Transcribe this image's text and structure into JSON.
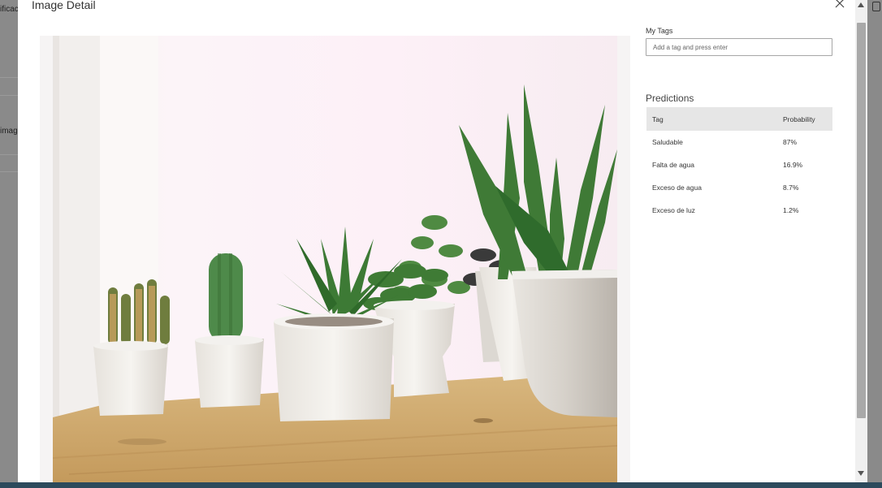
{
  "background": {
    "fragments": [
      "ificac",
      "image"
    ]
  },
  "modal": {
    "title": "Image Detail",
    "close_icon": "close-icon"
  },
  "photo": {
    "subject": "plant-photo"
  },
  "my_tags": {
    "label": "My Tags",
    "placeholder": "Add a tag and press enter",
    "value": ""
  },
  "predictions": {
    "title": "Predictions",
    "columns": [
      "Tag",
      "Probability"
    ],
    "rows": [
      {
        "tag": "Saludable",
        "probability": "87%"
      },
      {
        "tag": "Falta de agua",
        "probability": "16.9%"
      },
      {
        "tag": "Exceso de agua",
        "probability": "8.7%"
      },
      {
        "tag": "Exceso de luz",
        "probability": "1.2%"
      }
    ]
  }
}
